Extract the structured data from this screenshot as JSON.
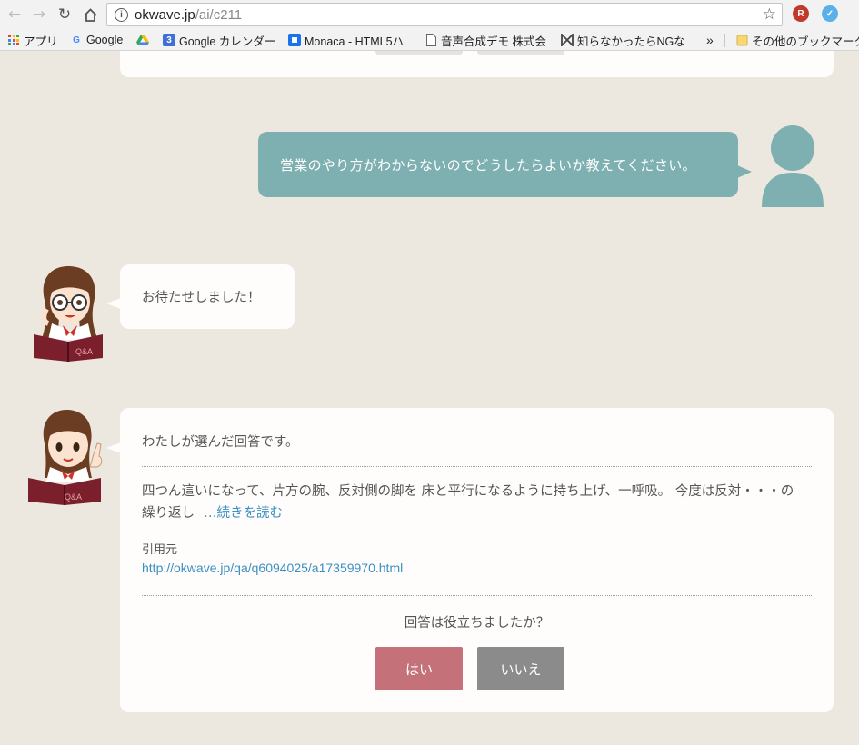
{
  "browser": {
    "url_host": "okwave.jp",
    "url_path": "/ai/c211",
    "bookmarks": [
      {
        "label": "アプリ",
        "icon": "apps-grid-icon"
      },
      {
        "label": "Google",
        "icon": "google-icon"
      },
      {
        "label": "",
        "icon": "google-drive-icon"
      },
      {
        "label": "Google カレンダー",
        "icon": "google-calendar-icon",
        "icon_text": "3"
      },
      {
        "label": "Monaca - HTML5ハ",
        "icon": "monaca-icon"
      },
      {
        "label": "音声合成デモ 株式会",
        "icon": "page-icon"
      },
      {
        "label": "知らなかったらNGな",
        "icon": "bookmark-site-icon"
      }
    ],
    "overflow": "»",
    "other_bookmarks": "その他のブックマーク"
  },
  "chat": {
    "user_message": "営業のやり方がわからないのでどうしたらよいか教えてください。",
    "bot_wait_message": "お待たせしました！",
    "answer": {
      "intro": "わたしが選んだ回答です。",
      "body": "四つん這いになって、片方の腕、反対側の脚を 床と平行になるように持ち上げ、一呼吸。 今度は反対・・・の繰り返し",
      "read_more": "…続きを読む",
      "cite_label": "引用元",
      "cite_url": "http://okwave.jp/qa/q6094025/a17359970.html",
      "question": "回答は役立ちましたか？",
      "yes_label": "はい",
      "no_label": "いいえ"
    },
    "avatar_book_label": "Q&A"
  },
  "colors": {
    "page_bg": "#ece8df",
    "user_bubble": "#7eafb1",
    "link": "#3c8fc2",
    "yes_button": "#c4717a",
    "no_button": "#8b8b8b"
  }
}
